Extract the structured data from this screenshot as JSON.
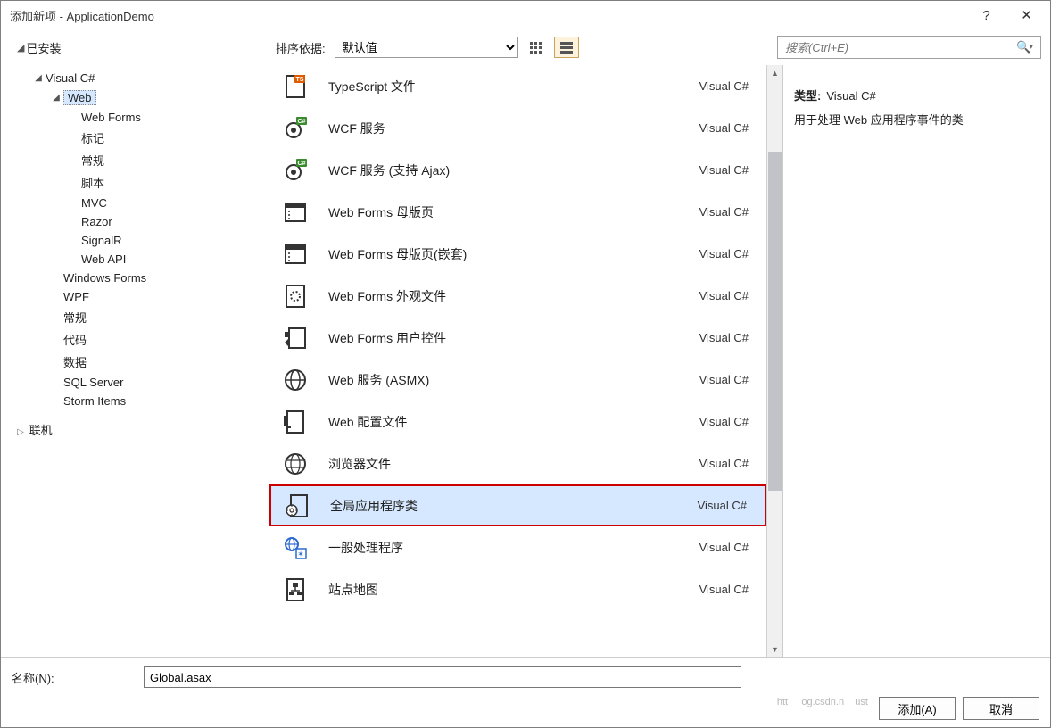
{
  "window": {
    "title": "添加新项 - ApplicationDemo"
  },
  "titlebar": {
    "help": "?",
    "close": "✕"
  },
  "toolbar": {
    "installed_label": "已安装",
    "sort_label": "排序依据:",
    "sort_value": "默认值",
    "search_placeholder": "搜索(Ctrl+E)"
  },
  "sidebar": {
    "root": "Visual C#",
    "web": "Web",
    "web_children": [
      "Web Forms",
      "标记",
      "常规",
      "脚本",
      "MVC",
      "Razor",
      "SignalR",
      "Web API"
    ],
    "others": [
      "Windows Forms",
      "WPF",
      "常规",
      "代码",
      "数据",
      "SQL Server",
      "Storm Items"
    ],
    "online": "联机"
  },
  "templates": [
    {
      "name": "TypeScript 文件",
      "lang": "Visual C#",
      "icon": "ts"
    },
    {
      "name": "WCF 服务",
      "lang": "Visual C#",
      "icon": "gear-cs"
    },
    {
      "name": "WCF 服务  (支持 Ajax)",
      "lang": "Visual C#",
      "icon": "gear-cs"
    },
    {
      "name": "Web Forms 母版页",
      "lang": "Visual C#",
      "icon": "master"
    },
    {
      "name": "Web Forms 母版页(嵌套)",
      "lang": "Visual C#",
      "icon": "master"
    },
    {
      "name": "Web Forms 外观文件",
      "lang": "Visual C#",
      "icon": "skin"
    },
    {
      "name": "Web Forms 用户控件",
      "lang": "Visual C#",
      "icon": "usercontrol"
    },
    {
      "name": "Web 服务 (ASMX)",
      "lang": "Visual C#",
      "icon": "globe"
    },
    {
      "name": "Web 配置文件",
      "lang": "Visual C#",
      "icon": "config"
    },
    {
      "name": "浏览器文件",
      "lang": "Visual C#",
      "icon": "globe-lines"
    },
    {
      "name": "全局应用程序类",
      "lang": "Visual C#",
      "icon": "global-app",
      "selected": true
    },
    {
      "name": "一般处理程序",
      "lang": "Visual C#",
      "icon": "handler"
    },
    {
      "name": "站点地图",
      "lang": "Visual C#",
      "icon": "sitemap"
    }
  ],
  "details": {
    "type_label": "类型:",
    "type_value": "Visual C#",
    "description": "用于处理 Web 应用程序事件的类"
  },
  "footer": {
    "name_label": "名称(N):",
    "name_value": "Global.asax",
    "add_label": "添加(A)",
    "cancel_label": "取消"
  }
}
